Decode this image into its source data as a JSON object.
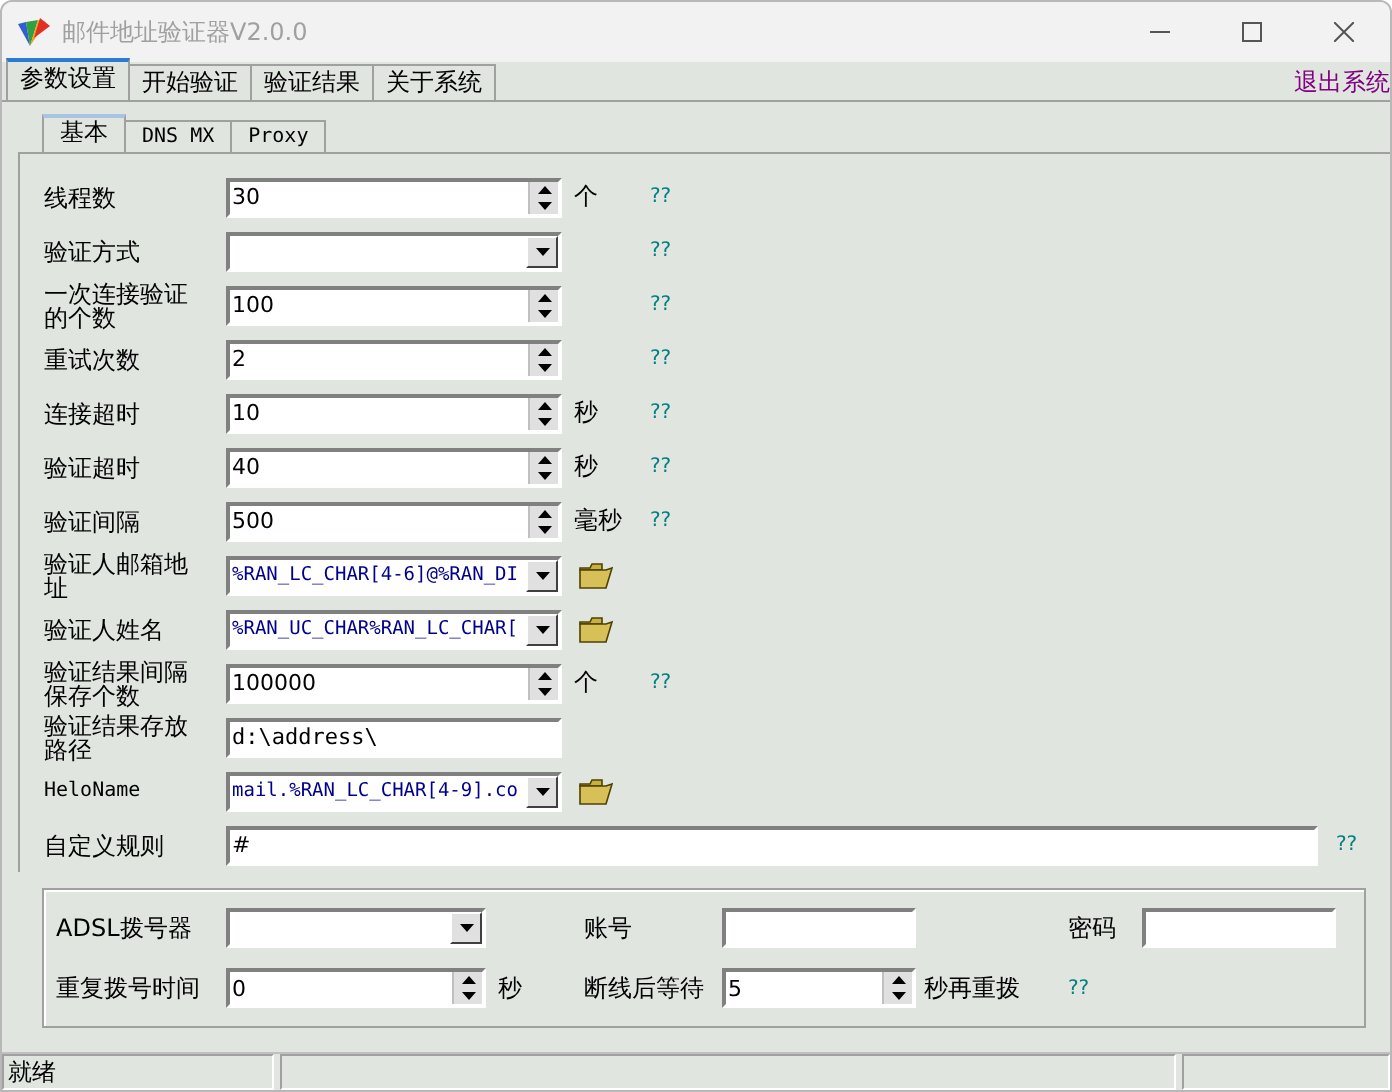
{
  "window": {
    "title": "邮件地址验证器V2.0.0"
  },
  "tabs": [
    {
      "label": "参数设置",
      "selected": true
    },
    {
      "label": "开始验证",
      "selected": false
    },
    {
      "label": "验证结果",
      "selected": false
    },
    {
      "label": "关于系统",
      "selected": false
    }
  ],
  "exit_link": "退出系统",
  "subtabs": [
    {
      "label": "基本",
      "selected": true
    },
    {
      "label": "DNS MX",
      "selected": false
    },
    {
      "label": "Proxy",
      "selected": false
    }
  ],
  "rows": [
    {
      "label": "线程数",
      "kind": "spin",
      "value": "30",
      "unit": "个",
      "help": "??"
    },
    {
      "label": "验证方式",
      "kind": "combo",
      "help": "??"
    },
    {
      "label": "一次连接验证的个数",
      "kind": "spin",
      "value": "100",
      "help": "??"
    },
    {
      "label": "重试次数",
      "kind": "spin",
      "value": "2",
      "help": "??"
    },
    {
      "label": "连接超时",
      "kind": "spin",
      "value": "10",
      "unit": "秒",
      "help": "??"
    },
    {
      "label": "验证超时",
      "kind": "spin",
      "value": "40",
      "unit": "秒",
      "help": "??"
    },
    {
      "label": "验证间隔",
      "kind": "spin",
      "value": "500",
      "unit": "毫秒",
      "help": "??"
    },
    {
      "label": "验证人邮箱地址",
      "kind": "browse",
      "value": "%RAN_LC_CHAR[4-6]@%RAN_DI"
    },
    {
      "label": "验证人姓名",
      "kind": "browse",
      "value": "%RAN_UC_CHAR%RAN_LC_CHAR["
    },
    {
      "label": "验证结果间隔保存个数",
      "kind": "spin",
      "value": "100000",
      "unit": "个",
      "help": "??"
    },
    {
      "label": "验证结果存放路径",
      "kind": "text",
      "value": "d:\\address\\"
    },
    {
      "label": "HeloName",
      "kind": "browse",
      "value": "mail.%RAN_LC_CHAR[4-9].co"
    },
    {
      "label": "自定义规则",
      "kind": "wide",
      "value": "#",
      "help": "??"
    }
  ],
  "dialup": {
    "adsl_label": "ADSL拨号器",
    "account_label": "账号",
    "password_label": "密码",
    "redial_label": "重复拨号时间",
    "redial_value": "0",
    "redial_unit": "秒",
    "wait_label": "断线后等待",
    "wait_value": "5",
    "wait_unit": "秒再重拨",
    "help": "??"
  },
  "status_bar": {
    "text": "就绪"
  }
}
